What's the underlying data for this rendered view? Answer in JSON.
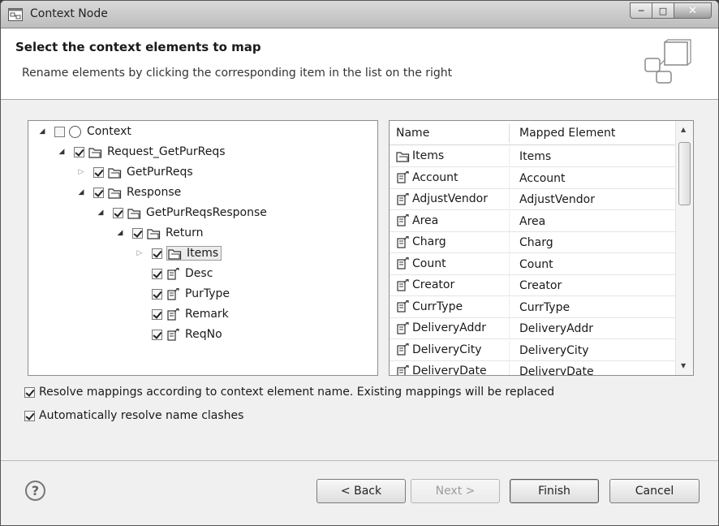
{
  "window": {
    "title": "Context Node"
  },
  "header": {
    "title": "Select the context elements to map",
    "description": "Rename elements by clicking the corresponding item in the list on the right"
  },
  "tree": [
    {
      "label": "Context",
      "depth": 0,
      "twisty": "expanded",
      "checked": false,
      "icon": "radio-circle-icon"
    },
    {
      "label": "Request_GetPurReqs",
      "depth": 1,
      "twisty": "expanded",
      "checked": true,
      "icon": "folder-icon"
    },
    {
      "label": "GetPurReqs",
      "depth": 2,
      "twisty": "collapsed",
      "checked": true,
      "icon": "folder-icon"
    },
    {
      "label": "Response",
      "depth": 2,
      "twisty": "expanded",
      "checked": true,
      "icon": "folder-icon"
    },
    {
      "label": "GetPurReqsResponse",
      "depth": 3,
      "twisty": "expanded",
      "checked": true,
      "icon": "folder-icon"
    },
    {
      "label": "Return",
      "depth": 4,
      "twisty": "expanded",
      "checked": true,
      "icon": "folder-icon"
    },
    {
      "label": "Items",
      "depth": 5,
      "twisty": "collapsed",
      "checked": true,
      "icon": "folder-icon",
      "selected": true
    },
    {
      "label": "Desc",
      "depth": 5,
      "twisty": "none",
      "checked": true,
      "icon": "attribute-icon"
    },
    {
      "label": "PurType",
      "depth": 5,
      "twisty": "none",
      "checked": true,
      "icon": "attribute-icon"
    },
    {
      "label": "Remark",
      "depth": 5,
      "twisty": "none",
      "checked": true,
      "icon": "attribute-icon"
    },
    {
      "label": "ReqNo",
      "depth": 5,
      "twisty": "none",
      "checked": true,
      "icon": "attribute-icon"
    }
  ],
  "table": {
    "columns": [
      "Name",
      "Mapped Element"
    ],
    "rows": [
      {
        "name": "Items",
        "mapped": "Items",
        "icon": "folder-icon"
      },
      {
        "name": "Account",
        "mapped": "Account",
        "icon": "attribute-icon"
      },
      {
        "name": "AdjustVendor",
        "mapped": "AdjustVendor",
        "icon": "attribute-icon"
      },
      {
        "name": "Area",
        "mapped": "Area",
        "icon": "attribute-icon"
      },
      {
        "name": "Charg",
        "mapped": "Charg",
        "icon": "attribute-icon"
      },
      {
        "name": "Count",
        "mapped": "Count",
        "icon": "attribute-icon"
      },
      {
        "name": "Creator",
        "mapped": "Creator",
        "icon": "attribute-icon"
      },
      {
        "name": "CurrType",
        "mapped": "CurrType",
        "icon": "attribute-icon"
      },
      {
        "name": "DeliveryAddr",
        "mapped": "DeliveryAddr",
        "icon": "attribute-icon"
      },
      {
        "name": "DeliveryCity",
        "mapped": "DeliveryCity",
        "icon": "attribute-icon"
      },
      {
        "name": "DeliveryDate",
        "mapped": "DeliveryDate",
        "icon": "attribute-icon"
      }
    ]
  },
  "options": {
    "resolve_mappings": {
      "label": "Resolve mappings according to context element name. Existing mappings will be replaced",
      "checked": true
    },
    "resolve_clashes": {
      "label": "Automatically resolve name clashes",
      "checked": true
    }
  },
  "footer": {
    "help_label": "?",
    "back_label": "< Back",
    "next_label": "Next >",
    "finish_label": "Finish",
    "cancel_label": "Cancel"
  },
  "colors": {
    "selected_border": "#9a9a9a",
    "window_bg": "#f0f0f0"
  }
}
